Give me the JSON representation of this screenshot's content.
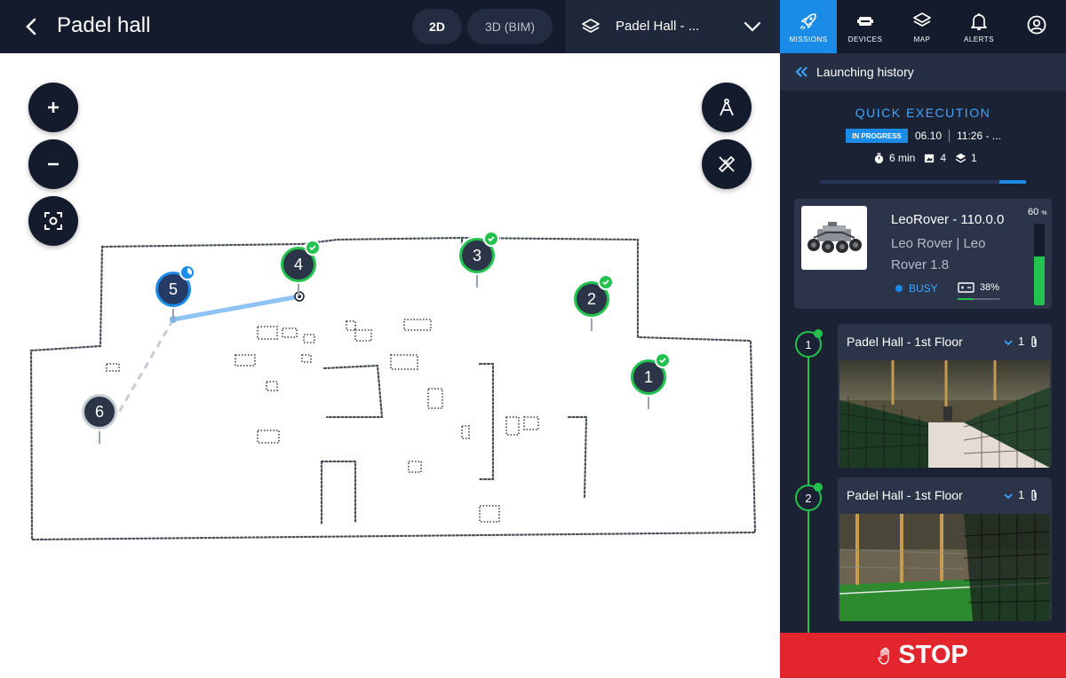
{
  "header": {
    "title": "Padel hall",
    "view_2d": "2D",
    "view_3d": "3D (BIM)",
    "floor_label": "Padel Hall - ..."
  },
  "nav": {
    "items": [
      {
        "label": "MISSIONS",
        "icon": "rocket-icon",
        "active": true
      },
      {
        "label": "DEVICES",
        "icon": "devices-icon",
        "active": false
      },
      {
        "label": "MAP",
        "icon": "layers-icon",
        "active": false
      },
      {
        "label": "ALERTS",
        "icon": "bell-icon",
        "active": false
      }
    ],
    "profile_icon": "user-circle-icon"
  },
  "map": {
    "controls": [
      "zoom-in",
      "zoom-out",
      "recenter",
      "measure",
      "edit"
    ],
    "waypoints": [
      {
        "number": "1",
        "status": "done"
      },
      {
        "number": "2",
        "status": "done"
      },
      {
        "number": "3",
        "status": "done"
      },
      {
        "number": "4",
        "status": "done"
      },
      {
        "number": "5",
        "status": "in-progress"
      },
      {
        "number": "6",
        "status": "pending"
      }
    ]
  },
  "panel": {
    "history_label": "Launching history",
    "mission_name": "QUICK EXECUTION",
    "status_badge": "IN PROGRESS",
    "date": "06.10",
    "time": "11:26 - ...",
    "duration": "6 min",
    "photos": "4",
    "layers": "1",
    "progress": 0.13,
    "robot": {
      "name": "LeoRover - 110.0.0",
      "model": "Leo Rover | Leo Rover 1.8",
      "status": "BUSY",
      "battery": "38%",
      "battery_value": 0.38,
      "level": "60",
      "level_unit": "%",
      "level_value": 0.6
    },
    "steps": [
      {
        "number": "1",
        "title": "Padel Hall - 1st Floor",
        "count": "1"
      },
      {
        "number": "2",
        "title": "Padel Hall - 1st Floor",
        "count": "1"
      }
    ],
    "stop_label": "STOP"
  },
  "colors": {
    "dark": "#141b2d",
    "panel": "#1b2234",
    "accent": "#1a8be6",
    "success": "#23c24f",
    "danger": "#e3262e"
  }
}
